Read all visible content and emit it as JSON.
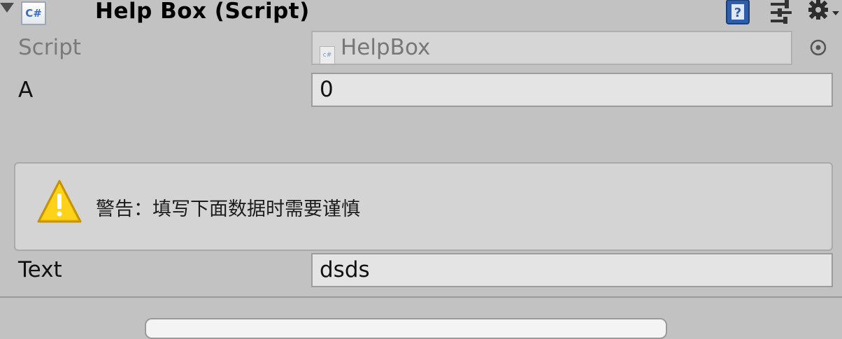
{
  "header": {
    "title": "Help Box (Script)",
    "script_icon_text": "C#",
    "icons": [
      "help-book-icon",
      "preset-sliders-icon",
      "gear-icon"
    ]
  },
  "properties": {
    "script": {
      "label": "Script",
      "value": "HelpBox",
      "icon": "csharp-script-icon"
    },
    "a": {
      "label": "A",
      "value": "0"
    },
    "text": {
      "label": "Text",
      "value": "dsds"
    }
  },
  "helpbox": {
    "type": "warning",
    "icon": "warning-triangle-icon",
    "message": "警告：填写下面数据时需要谨慎"
  },
  "colors": {
    "inspector_bg": "#c2c2c2",
    "field_bg": "#e4e4e4",
    "helpbox_bg": "#d4d4d4",
    "warning_yellow": "#f5c400"
  }
}
